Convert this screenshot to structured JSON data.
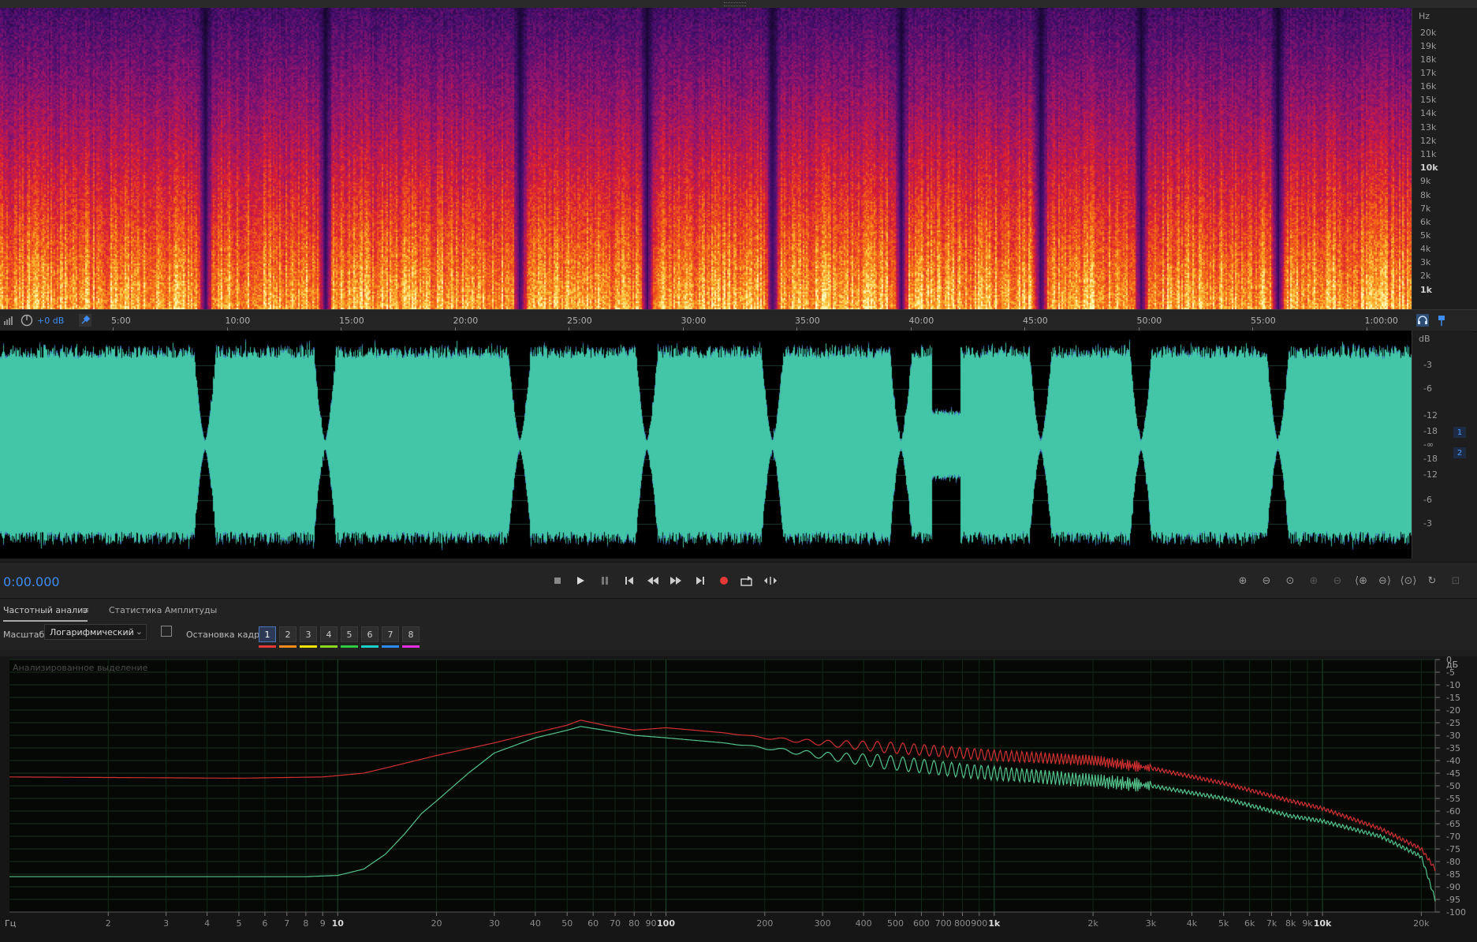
{
  "spectral": {
    "hz_unit": "Hz",
    "hz_labels": [
      {
        "text": "20k",
        "frac": 0.083
      },
      {
        "text": "19k",
        "frac": 0.128
      },
      {
        "text": "18k",
        "frac": 0.172
      },
      {
        "text": "17k",
        "frac": 0.217
      },
      {
        "text": "16k",
        "frac": 0.262
      },
      {
        "text": "15k",
        "frac": 0.307
      },
      {
        "text": "14k",
        "frac": 0.352
      },
      {
        "text": "13k",
        "frac": 0.398
      },
      {
        "text": "12k",
        "frac": 0.443
      },
      {
        "text": "11k",
        "frac": 0.488
      },
      {
        "text": "10k",
        "frac": 0.532,
        "bold": true
      },
      {
        "text": "9k",
        "frac": 0.577
      },
      {
        "text": "8k",
        "frac": 0.622
      },
      {
        "text": "7k",
        "frac": 0.667
      },
      {
        "text": "6k",
        "frac": 0.712
      },
      {
        "text": "5k",
        "frac": 0.757
      },
      {
        "text": "4k",
        "frac": 0.801
      },
      {
        "text": "3k",
        "frac": 0.846
      },
      {
        "text": "2k",
        "frac": 0.891
      },
      {
        "text": "1k",
        "frac": 0.936,
        "bold": true
      }
    ]
  },
  "timeline": {
    "gain_label": "+0 dB",
    "labels": [
      "5:00",
      "10:00",
      "15:00",
      "20:00",
      "25:00",
      "30:00",
      "35:00",
      "40:00",
      "45:00",
      "50:00",
      "55:00",
      "1:00:00"
    ]
  },
  "waveform": {
    "db_unit": "dB",
    "db_labels": [
      "-3",
      "-6",
      "-12",
      "-18",
      "-∞",
      "-18",
      "-12",
      "-6",
      "-3"
    ],
    "channel1": "1",
    "channel2": "2",
    "color": "#43c6a8"
  },
  "transport": {
    "timecode": "0:00.000",
    "buttons": [
      "stop",
      "play",
      "pause",
      "to-start",
      "rewind",
      "fast-forward",
      "to-end",
      "record",
      "loop",
      "skip-selection"
    ]
  },
  "panel": {
    "tabs": [
      "Частотный анализ",
      "Статистика Амплитуды"
    ],
    "menu_icon": "≡",
    "scale_label": "Масштаб:",
    "scale_value": "Логарифмический",
    "freeze_label": "Остановка кадра:",
    "freeze_buttons": [
      "1",
      "2",
      "3",
      "4",
      "5",
      "6",
      "7",
      "8"
    ],
    "freeze_colors": [
      "#e53935",
      "#ff8c1a",
      "#f2e400",
      "#8bd61e",
      "#2ecc40",
      "#18d1c9",
      "#2a8cff",
      "#e52ee5"
    ],
    "graph_label": "Анализированное выделение"
  },
  "chart_data": {
    "type": "line",
    "title": "",
    "xlabel": "Гц",
    "ylabel": "дБ",
    "x_scale": "log",
    "xlim": [
      1,
      22050
    ],
    "ylim": [
      -100,
      0
    ],
    "x_ticks": [
      {
        "v": 2,
        "t": "2"
      },
      {
        "v": 3,
        "t": "3"
      },
      {
        "v": 4,
        "t": "4"
      },
      {
        "v": 5,
        "t": "5"
      },
      {
        "v": 6,
        "t": "6"
      },
      {
        "v": 7,
        "t": "7"
      },
      {
        "v": 8,
        "t": "8"
      },
      {
        "v": 9,
        "t": "9"
      },
      {
        "v": 10,
        "t": "10",
        "bold": true
      },
      {
        "v": 20,
        "t": "20"
      },
      {
        "v": 30,
        "t": "30"
      },
      {
        "v": 40,
        "t": "40"
      },
      {
        "v": 50,
        "t": "50"
      },
      {
        "v": 60,
        "t": "60"
      },
      {
        "v": 70,
        "t": "70"
      },
      {
        "v": 80,
        "t": "80"
      },
      {
        "v": 90,
        "t": "90"
      },
      {
        "v": 100,
        "t": "100",
        "bold": true
      },
      {
        "v": 200,
        "t": "200"
      },
      {
        "v": 300,
        "t": "300"
      },
      {
        "v": 400,
        "t": "400"
      },
      {
        "v": 500,
        "t": "500"
      },
      {
        "v": 600,
        "t": "600"
      },
      {
        "v": 700,
        "t": "700"
      },
      {
        "v": 800,
        "t": "800"
      },
      {
        "v": 900,
        "t": "900"
      },
      {
        "v": 1000,
        "t": "1k",
        "bold": true
      },
      {
        "v": 2000,
        "t": "2k"
      },
      {
        "v": 3000,
        "t": "3k"
      },
      {
        "v": 4000,
        "t": "4k"
      },
      {
        "v": 5000,
        "t": "5k"
      },
      {
        "v": 6000,
        "t": "6k"
      },
      {
        "v": 7000,
        "t": "7k"
      },
      {
        "v": 8000,
        "t": "8k"
      },
      {
        "v": 9000,
        "t": "9k"
      },
      {
        "v": 10000,
        "t": "10k",
        "bold": true
      },
      {
        "v": 20000,
        "t": "20k"
      }
    ],
    "x_unit_label": "Гц",
    "y_ticks": [
      0,
      -5,
      -10,
      -15,
      -20,
      -25,
      -30,
      -35,
      -40,
      -45,
      -50,
      -55,
      -60,
      -65,
      -70,
      -75,
      -80,
      -85,
      -90,
      -95,
      -100
    ],
    "series": [
      {
        "color": "#d23030",
        "points": [
          [
            1,
            -46.5
          ],
          [
            5,
            -47
          ],
          [
            9,
            -46.5
          ],
          [
            12,
            -45
          ],
          [
            15,
            -42
          ],
          [
            20,
            -38
          ],
          [
            30,
            -33
          ],
          [
            40,
            -29
          ],
          [
            50,
            -26
          ],
          [
            55,
            -24
          ],
          [
            65,
            -26
          ],
          [
            80,
            -28
          ],
          [
            100,
            -27
          ],
          [
            150,
            -29
          ],
          [
            200,
            -31
          ],
          [
            300,
            -33
          ],
          [
            500,
            -35
          ],
          [
            800,
            -37
          ],
          [
            1000,
            -38
          ],
          [
            2000,
            -40
          ],
          [
            3000,
            -43
          ],
          [
            5000,
            -49
          ],
          [
            8000,
            -56
          ],
          [
            10000,
            -59
          ],
          [
            15000,
            -67
          ],
          [
            20000,
            -75
          ],
          [
            22050,
            -83
          ]
        ]
      },
      {
        "color": "#54c48c",
        "points": [
          [
            1,
            -86
          ],
          [
            8,
            -86
          ],
          [
            10,
            -85.5
          ],
          [
            12,
            -83
          ],
          [
            14,
            -77
          ],
          [
            16,
            -69
          ],
          [
            18,
            -61
          ],
          [
            20,
            -56
          ],
          [
            25,
            -45
          ],
          [
            30,
            -37
          ],
          [
            40,
            -31
          ],
          [
            50,
            -28
          ],
          [
            55,
            -26.5
          ],
          [
            65,
            -28
          ],
          [
            80,
            -30
          ],
          [
            100,
            -31
          ],
          [
            150,
            -33
          ],
          [
            200,
            -35
          ],
          [
            300,
            -38
          ],
          [
            500,
            -41
          ],
          [
            800,
            -44
          ],
          [
            1000,
            -45
          ],
          [
            2000,
            -48
          ],
          [
            3000,
            -50
          ],
          [
            5000,
            -55
          ],
          [
            8000,
            -62
          ],
          [
            10000,
            -64
          ],
          [
            15000,
            -70
          ],
          [
            20000,
            -78
          ],
          [
            22050,
            -95
          ]
        ]
      }
    ]
  }
}
